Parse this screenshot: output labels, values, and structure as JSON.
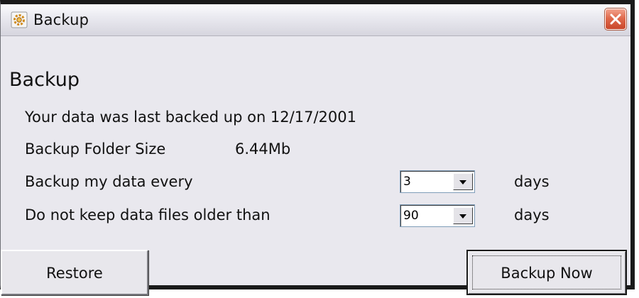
{
  "window": {
    "title": "Backup",
    "icon": "gear-icon",
    "close_icon": "close-icon"
  },
  "content": {
    "heading": "Backup",
    "last_backup_text": "Your data was last backed up on 12/17/2001",
    "folder_size_label": "Backup Folder Size",
    "folder_size_value": "6.44Mb",
    "backup_every_label": "Backup my data every",
    "backup_every_value": "3",
    "backup_every_unit": "days",
    "keep_files_label": "Do not keep data files older than",
    "keep_files_value": "90",
    "keep_files_unit": "days"
  },
  "buttons": {
    "restore_label": "Restore",
    "backup_now_label": "Backup Now"
  },
  "colors": {
    "close_button": "#d9573a",
    "window_background": "#e9e8ee"
  }
}
